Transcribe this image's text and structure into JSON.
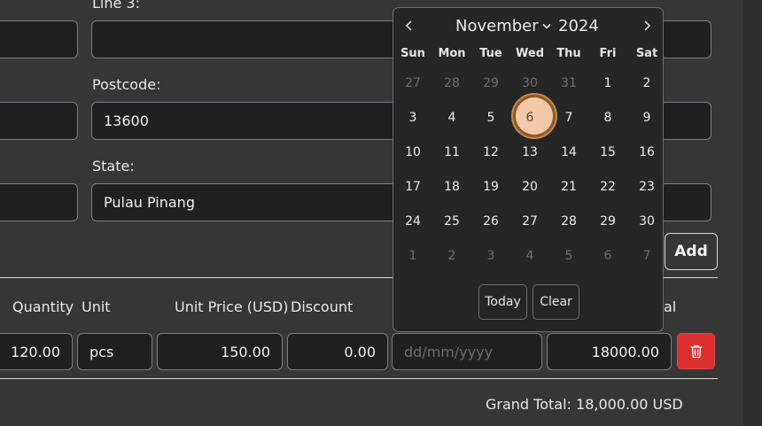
{
  "address": {
    "line3_label": "Line 3:",
    "postcode_label": "Postcode:",
    "postcode_value": "13600",
    "state_label": "State:",
    "state_value": "Pulau Pinang"
  },
  "add_button": "Add",
  "table": {
    "headers": {
      "quantity": "Quantity",
      "unit": "Unit",
      "unit_price": "Unit Price (USD)",
      "discount": "Discount",
      "total_fragment": "al"
    },
    "row": {
      "quantity": "120.00",
      "unit": "pcs",
      "unit_price": "150.00",
      "discount": "0.00",
      "date_placeholder": "dd/mm/yyyy",
      "total": "18000.00"
    }
  },
  "grand_total": "Grand Total: 18,000.00 USD",
  "calendar": {
    "month": "November",
    "year": "2024",
    "weekdays": [
      "Sun",
      "Mon",
      "Tue",
      "Wed",
      "Thu",
      "Fri",
      "Sat"
    ],
    "weeks": [
      [
        "27",
        "28",
        "29",
        "30",
        "31",
        "1",
        "2"
      ],
      [
        "3",
        "4",
        "5",
        "6",
        "7",
        "8",
        "9"
      ],
      [
        "10",
        "11",
        "12",
        "13",
        "14",
        "15",
        "16"
      ],
      [
        "17",
        "18",
        "19",
        "20",
        "21",
        "22",
        "23"
      ],
      [
        "24",
        "25",
        "26",
        "27",
        "28",
        "29",
        "30"
      ],
      [
        "1",
        "2",
        "3",
        "4",
        "5",
        "6",
        "7"
      ]
    ],
    "selected_day": "6",
    "today_label": "Today",
    "clear_label": "Clear"
  },
  "colors": {
    "background": "#363636",
    "field": "#202020",
    "delete": "#dc2f2f",
    "selected": "#f3c8a6"
  }
}
